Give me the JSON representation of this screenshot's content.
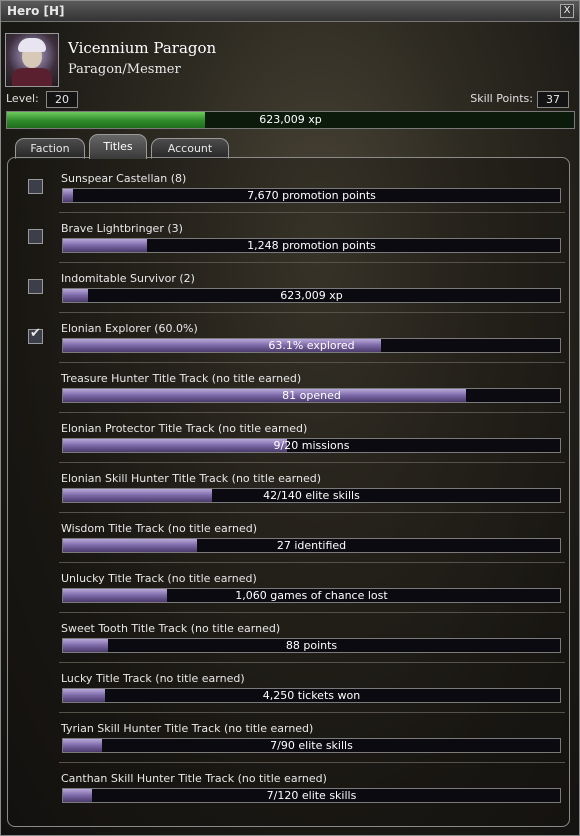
{
  "window": {
    "title": "Hero  [H]",
    "close_label": "X"
  },
  "hero": {
    "name": "Vicennium Paragon",
    "profession": "Paragon/Mesmer"
  },
  "stats": {
    "level_label": "Level:",
    "level": "20",
    "skill_points_label": "Skill Points:",
    "skill_points": "37"
  },
  "xp": {
    "text": "623,009 xp",
    "fill_fraction": 0.35
  },
  "tabs": [
    {
      "label": "Faction"
    },
    {
      "label": "Titles"
    },
    {
      "label": "Account"
    }
  ],
  "titles": [
    {
      "label": "Sunspear Castellan (8)",
      "progress": "7,670 promotion points",
      "fill_fraction": 0.02,
      "checkbox": true,
      "checked": false
    },
    {
      "label": "Brave Lightbringer (3)",
      "progress": "1,248 promotion points",
      "fill_fraction": 0.17,
      "checkbox": true,
      "checked": false
    },
    {
      "label": "Indomitable Survivor (2)",
      "progress": "623,009 xp",
      "fill_fraction": 0.05,
      "checkbox": true,
      "checked": false
    },
    {
      "label": "Elonian Explorer (60.0%)",
      "progress": "63.1% explored",
      "fill_fraction": 0.64,
      "checkbox": true,
      "checked": true
    },
    {
      "label": "Treasure Hunter Title Track (no title earned)",
      "progress": "81 opened",
      "fill_fraction": 0.81,
      "checkbox": false
    },
    {
      "label": "Elonian Protector Title Track (no title earned)",
      "progress": "9/20 missions",
      "fill_fraction": 0.45,
      "checkbox": false
    },
    {
      "label": "Elonian Skill Hunter Title Track (no title earned)",
      "progress": "42/140 elite skills",
      "fill_fraction": 0.3,
      "checkbox": false
    },
    {
      "label": "Wisdom Title Track (no title earned)",
      "progress": "27 identified",
      "fill_fraction": 0.27,
      "checkbox": false
    },
    {
      "label": "Unlucky Title Track (no title earned)",
      "progress": "1,060 games of chance lost",
      "fill_fraction": 0.21,
      "checkbox": false
    },
    {
      "label": "Sweet Tooth Title Track (no title earned)",
      "progress": "88 points",
      "fill_fraction": 0.09,
      "checkbox": false
    },
    {
      "label": "Lucky Title Track (no title earned)",
      "progress": "4,250 tickets won",
      "fill_fraction": 0.085,
      "checkbox": false
    },
    {
      "label": "Tyrian Skill Hunter Title Track (no title earned)",
      "progress": "7/90 elite skills",
      "fill_fraction": 0.078,
      "checkbox": false
    },
    {
      "label": "Canthan Skill Hunter Title Track (no title earned)",
      "progress": "7/120 elite skills",
      "fill_fraction": 0.058,
      "checkbox": false
    }
  ]
}
